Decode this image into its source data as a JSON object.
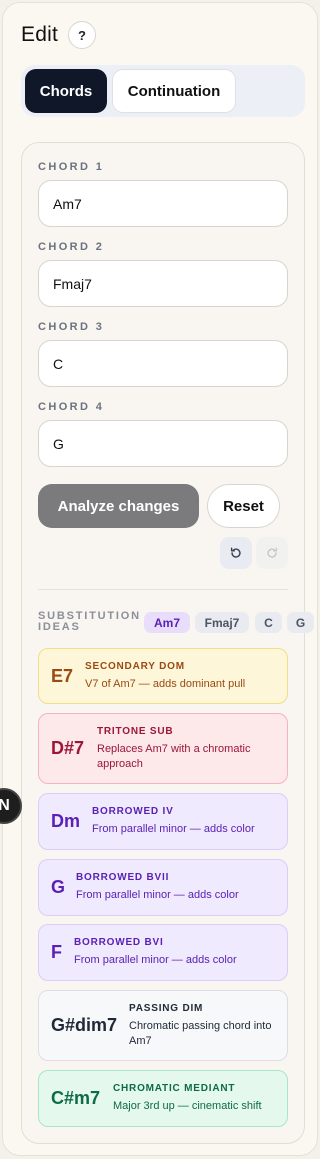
{
  "header": {
    "title": "Edit",
    "help_label": "?"
  },
  "tabs": [
    {
      "label": "Chords"
    },
    {
      "label": "Continuation"
    }
  ],
  "chords": [
    {
      "label": "CHORD 1",
      "value": "Am7"
    },
    {
      "label": "CHORD 2",
      "value": "Fmaj7"
    },
    {
      "label": "CHORD 3",
      "value": "C"
    },
    {
      "label": "CHORD 4",
      "value": "G"
    }
  ],
  "actions": {
    "analyze_label": "Analyze changes",
    "reset_label": "Reset"
  },
  "substitutions": {
    "heading": "SUBSTITUTION IDEAS",
    "chips": [
      "Am7",
      "Fmaj7",
      "C",
      "G"
    ],
    "items": [
      {
        "chord": "E7",
        "kind": "SECONDARY DOM",
        "desc": "V7 of Am7 — adds dominant pull"
      },
      {
        "chord": "D#7",
        "kind": "TRITONE SUB",
        "desc": "Replaces Am7 with a chromatic approach"
      },
      {
        "chord": "Dm",
        "kind": "BORROWED IV",
        "desc": "From parallel minor — adds color"
      },
      {
        "chord": "G",
        "kind": "BORROWED BVII",
        "desc": "From parallel minor — adds color"
      },
      {
        "chord": "F",
        "kind": "BORROWED BVI",
        "desc": "From parallel minor — adds color"
      },
      {
        "chord": "G#dim7",
        "kind": "PASSING DIM",
        "desc": "Chromatic passing chord into Am7"
      },
      {
        "chord": "C#m7",
        "kind": "CHROMATIC MEDIANT",
        "desc": "Major 3rd up — cinematic shift"
      }
    ]
  },
  "edge_badge": {
    "label": "N"
  },
  "colors": {
    "accent_dark": "#0f1729",
    "accent_purple": "#5b21b6",
    "button_gray": "#7b7b7e"
  },
  "icons": {
    "undo": "undo-icon",
    "redo": "redo-icon"
  }
}
